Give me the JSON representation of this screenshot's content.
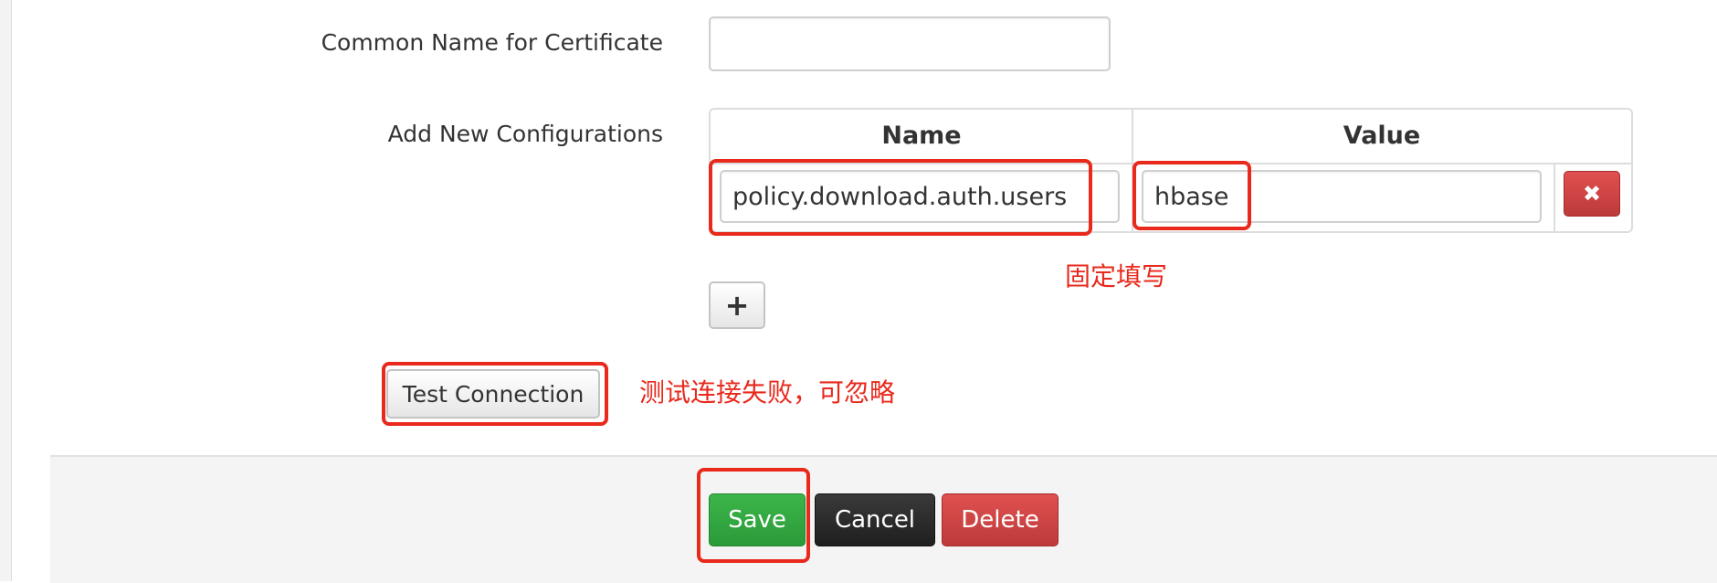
{
  "form": {
    "common_name_label": "Common Name for Certificate",
    "common_name_value": "",
    "configs_label": "Add New Configurations",
    "table": {
      "name_header": "Name",
      "value_header": "Value",
      "rows": [
        {
          "name": "policy.download.auth.users",
          "value": "hbase"
        }
      ]
    },
    "add_label": "+",
    "remove_label": "✖",
    "test_connection_label": "Test Connection"
  },
  "annotations": {
    "fixed_fill_note": "固定填写",
    "test_note": "测试连接失败，可忽略"
  },
  "footer": {
    "save_label": "Save",
    "cancel_label": "Cancel",
    "delete_label": "Delete"
  },
  "colors": {
    "highlight": "#e8291c",
    "save_green": "#2fa83d",
    "cancel_dark": "#2b2b2b",
    "delete_red": "#d04545"
  }
}
